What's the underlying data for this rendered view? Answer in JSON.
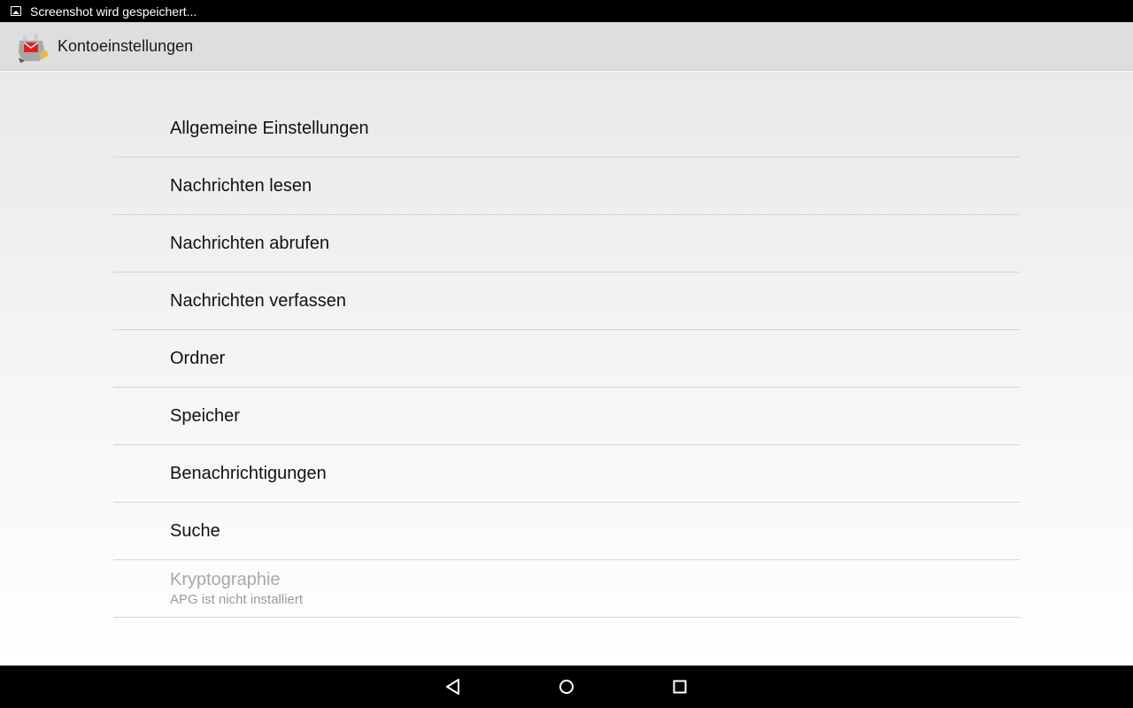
{
  "status_bar": {
    "notification_text": "Screenshot wird gespeichert...",
    "notification_icon": "image-icon"
  },
  "action_bar": {
    "title": "Kontoeinstellungen",
    "app_icon": "k9-mail-icon"
  },
  "preferences": [
    {
      "title": "Allgemeine Einstellungen"
    },
    {
      "title": "Nachrichten lesen"
    },
    {
      "title": "Nachrichten abrufen"
    },
    {
      "title": "Nachrichten verfassen"
    },
    {
      "title": "Ordner"
    },
    {
      "title": "Speicher"
    },
    {
      "title": "Benachrichtigungen"
    },
    {
      "title": "Suche"
    },
    {
      "title": "Kryptographie",
      "summary": "APG ist nicht installiert",
      "enabled": false
    }
  ],
  "nav_bar": {
    "back_icon": "back-icon",
    "home_icon": "home-icon",
    "recents_icon": "recents-icon"
  }
}
